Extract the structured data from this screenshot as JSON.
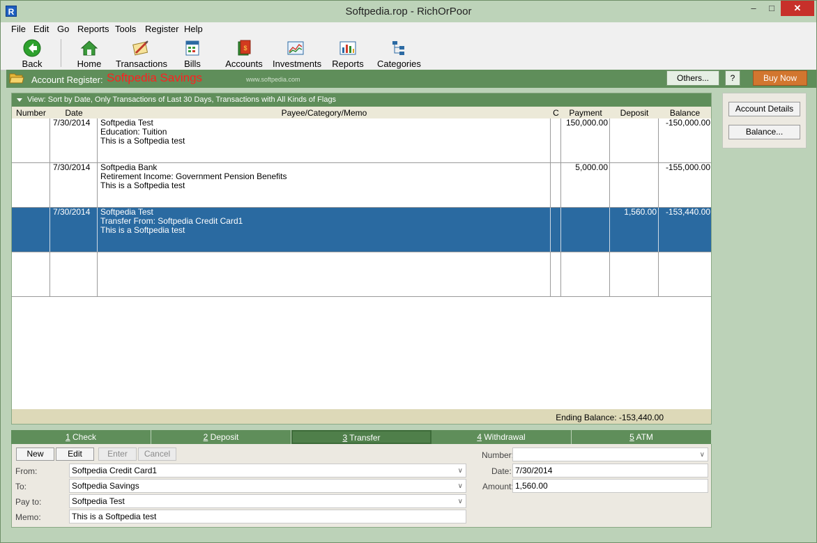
{
  "window": {
    "title": "Softpedia.rop - RichOrPoor",
    "app_icon": "R",
    "min_glyph": "–",
    "max_glyph": "□",
    "close_glyph": "✕"
  },
  "menu": [
    "File",
    "Edit",
    "Go",
    "Reports",
    "Tools",
    "Register",
    "Help"
  ],
  "toolbar": {
    "back": "Back",
    "home": "Home",
    "transactions": "Transactions",
    "bills": "Bills",
    "accounts": "Accounts",
    "investments": "Investments",
    "reports": "Reports",
    "categories": "Categories"
  },
  "header": {
    "label": "Account Register:",
    "account": "Softpedia Savings",
    "watermark": "www.softpedia.com",
    "others": "Others...",
    "help": "?",
    "buy_now": "Buy Now"
  },
  "register": {
    "view_text": "View: Sort by Date, Only Transactions of Last 30 Days, Transactions with All Kinds of Flags",
    "columns": {
      "number": "Number",
      "date": "Date",
      "payee": "Payee/Category/Memo",
      "c": "C",
      "payment": "Payment",
      "deposit": "Deposit",
      "balance": "Balance"
    },
    "rows": [
      {
        "number": "",
        "date": "7/30/2014",
        "payee": "Softpedia Test",
        "category": "Education: Tuition",
        "memo": "This is a Softpedia test",
        "c": "",
        "payment": "150,000.00",
        "deposit": "",
        "balance": "-150,000.00"
      },
      {
        "number": "",
        "date": "7/30/2014",
        "payee": "Softpedia Bank",
        "category": "Retirement Income: Government Pension Benefits",
        "memo": "This is a Softpedia test",
        "c": "",
        "payment": "5,000.00",
        "deposit": "",
        "balance": "-155,000.00"
      },
      {
        "number": "",
        "date": "7/30/2014",
        "payee": "Softpedia Test",
        "category": "Transfer From: Softpedia Credit Card1",
        "memo": "This is a Softpedia test",
        "c": "",
        "payment": "",
        "deposit": "1,560.00",
        "balance": "-153,440.00"
      },
      {
        "number": "",
        "date": "",
        "payee": "",
        "category": "",
        "memo": "",
        "c": "",
        "payment": "",
        "deposit": "",
        "balance": ""
      }
    ],
    "ending_balance": "Ending Balance:  -153,440.00"
  },
  "side": {
    "account_details": "Account Details",
    "balance": "Balance..."
  },
  "tabs": [
    {
      "key": "1",
      "label": " Check"
    },
    {
      "key": "2",
      "label": " Deposit"
    },
    {
      "key": "3",
      "label": " Transfer"
    },
    {
      "key": "4",
      "label": " Withdrawal"
    },
    {
      "key": "5",
      "label": " ATM"
    }
  ],
  "form": {
    "new": "New",
    "edit": "Edit",
    "enter": "Enter",
    "cancel": "Cancel",
    "from_label": "From:",
    "from_value": "Softpedia Credit Card1",
    "to_label": "To:",
    "to_value": "Softpedia Savings",
    "payto_label": "Pay to:",
    "payto_value": "Softpedia Test",
    "memo_label": "Memo:",
    "memo_value": "This is a Softpedia test",
    "number_label": "Number:",
    "number_value": "",
    "date_label": "Date:",
    "date_value": "7/30/2014",
    "amount_label": "Amount:",
    "amount_value": "1,560.00"
  },
  "icons": {
    "chevron": "∨"
  }
}
